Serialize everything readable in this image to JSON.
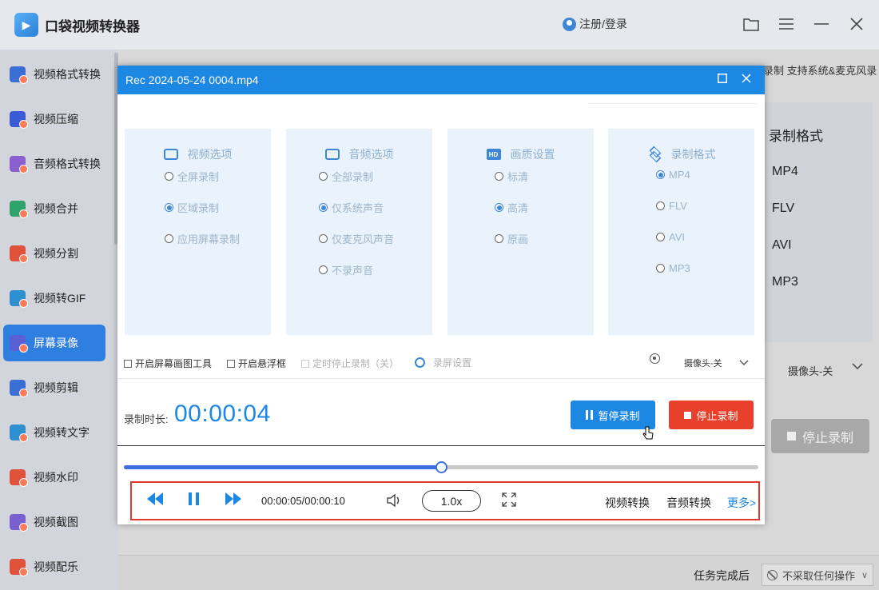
{
  "app": {
    "title": "口袋视频转换器",
    "login": "注册/登录"
  },
  "sidebar": {
    "items": [
      {
        "label": "视频格式转换",
        "color": "#3b6fd6"
      },
      {
        "label": "视频压缩",
        "color": "#3b5bd6"
      },
      {
        "label": "音频格式转换",
        "color": "#8a5fd0"
      },
      {
        "label": "视频合并",
        "color": "#2fa36b"
      },
      {
        "label": "视频分割",
        "color": "#e0523b"
      },
      {
        "label": "视频转GIF",
        "color": "#2f8fd0"
      },
      {
        "label": "屏幕录像",
        "color": "#5a5fd6",
        "active": true
      },
      {
        "label": "视频剪辑",
        "color": "#3b6fd6"
      },
      {
        "label": "视频转文字",
        "color": "#2f8fd0"
      },
      {
        "label": "视频水印",
        "color": "#e0523b"
      },
      {
        "label": "视频截图",
        "color": "#7a5fd0"
      },
      {
        "label": "视频配乐",
        "color": "#e0523b"
      }
    ]
  },
  "background": {
    "top_text": "录制 支持系统&麦克风录",
    "format_title": "录制格式",
    "format_options": [
      "MP4",
      "FLV",
      "AVI",
      "MP3"
    ],
    "camera": "摄像头-关",
    "stop_button": "停止录制",
    "task_label": "任务完成后",
    "task_option": "不采取任何操作"
  },
  "player": {
    "title": "Rec 2024-05-24 0004.mp4",
    "panels": [
      {
        "title": "视频选项",
        "icon": "video-icon",
        "options": [
          {
            "label": "全屏录制",
            "checked": false
          },
          {
            "label": "区域录制",
            "checked": true
          },
          {
            "label": "应用屏幕录制",
            "checked": false
          }
        ]
      },
      {
        "title": "音频选项",
        "icon": "audio-wave-icon",
        "options": [
          {
            "label": "全部录制",
            "checked": false
          },
          {
            "label": "仅系统声音",
            "checked": true
          },
          {
            "label": "仅麦克风声音",
            "checked": false
          },
          {
            "label": "不录声音",
            "checked": false
          }
        ]
      },
      {
        "title": "画质设置",
        "icon": "hd-icon",
        "options": [
          {
            "label": "标清",
            "checked": false
          },
          {
            "label": "高清",
            "checked": true
          },
          {
            "label": "原画",
            "checked": false
          }
        ]
      },
      {
        "title": "录制格式",
        "icon": "layers-icon",
        "options": [
          {
            "label": "MP4",
            "checked": true
          },
          {
            "label": "FLV",
            "checked": false
          },
          {
            "label": "AVI",
            "checked": false
          },
          {
            "label": "MP3",
            "checked": false
          }
        ]
      }
    ],
    "tools": {
      "draw_tool": "开启屏幕画图工具",
      "float_frame": "开启悬浮框",
      "timed_stop": "定时停止录制（关）",
      "settings": "录屏设置",
      "camera": "摄像头-关"
    },
    "duration_label": "录制时长:",
    "duration_value": "00:00:04",
    "pause_button": "暂停录制",
    "stop_button": "停止录制",
    "progress": 0.5,
    "time_display": "00:00:05/00:00:10",
    "speed": "1.0x",
    "link_video": "视频转换",
    "link_audio": "音频转换",
    "link_more": "更多>"
  }
}
